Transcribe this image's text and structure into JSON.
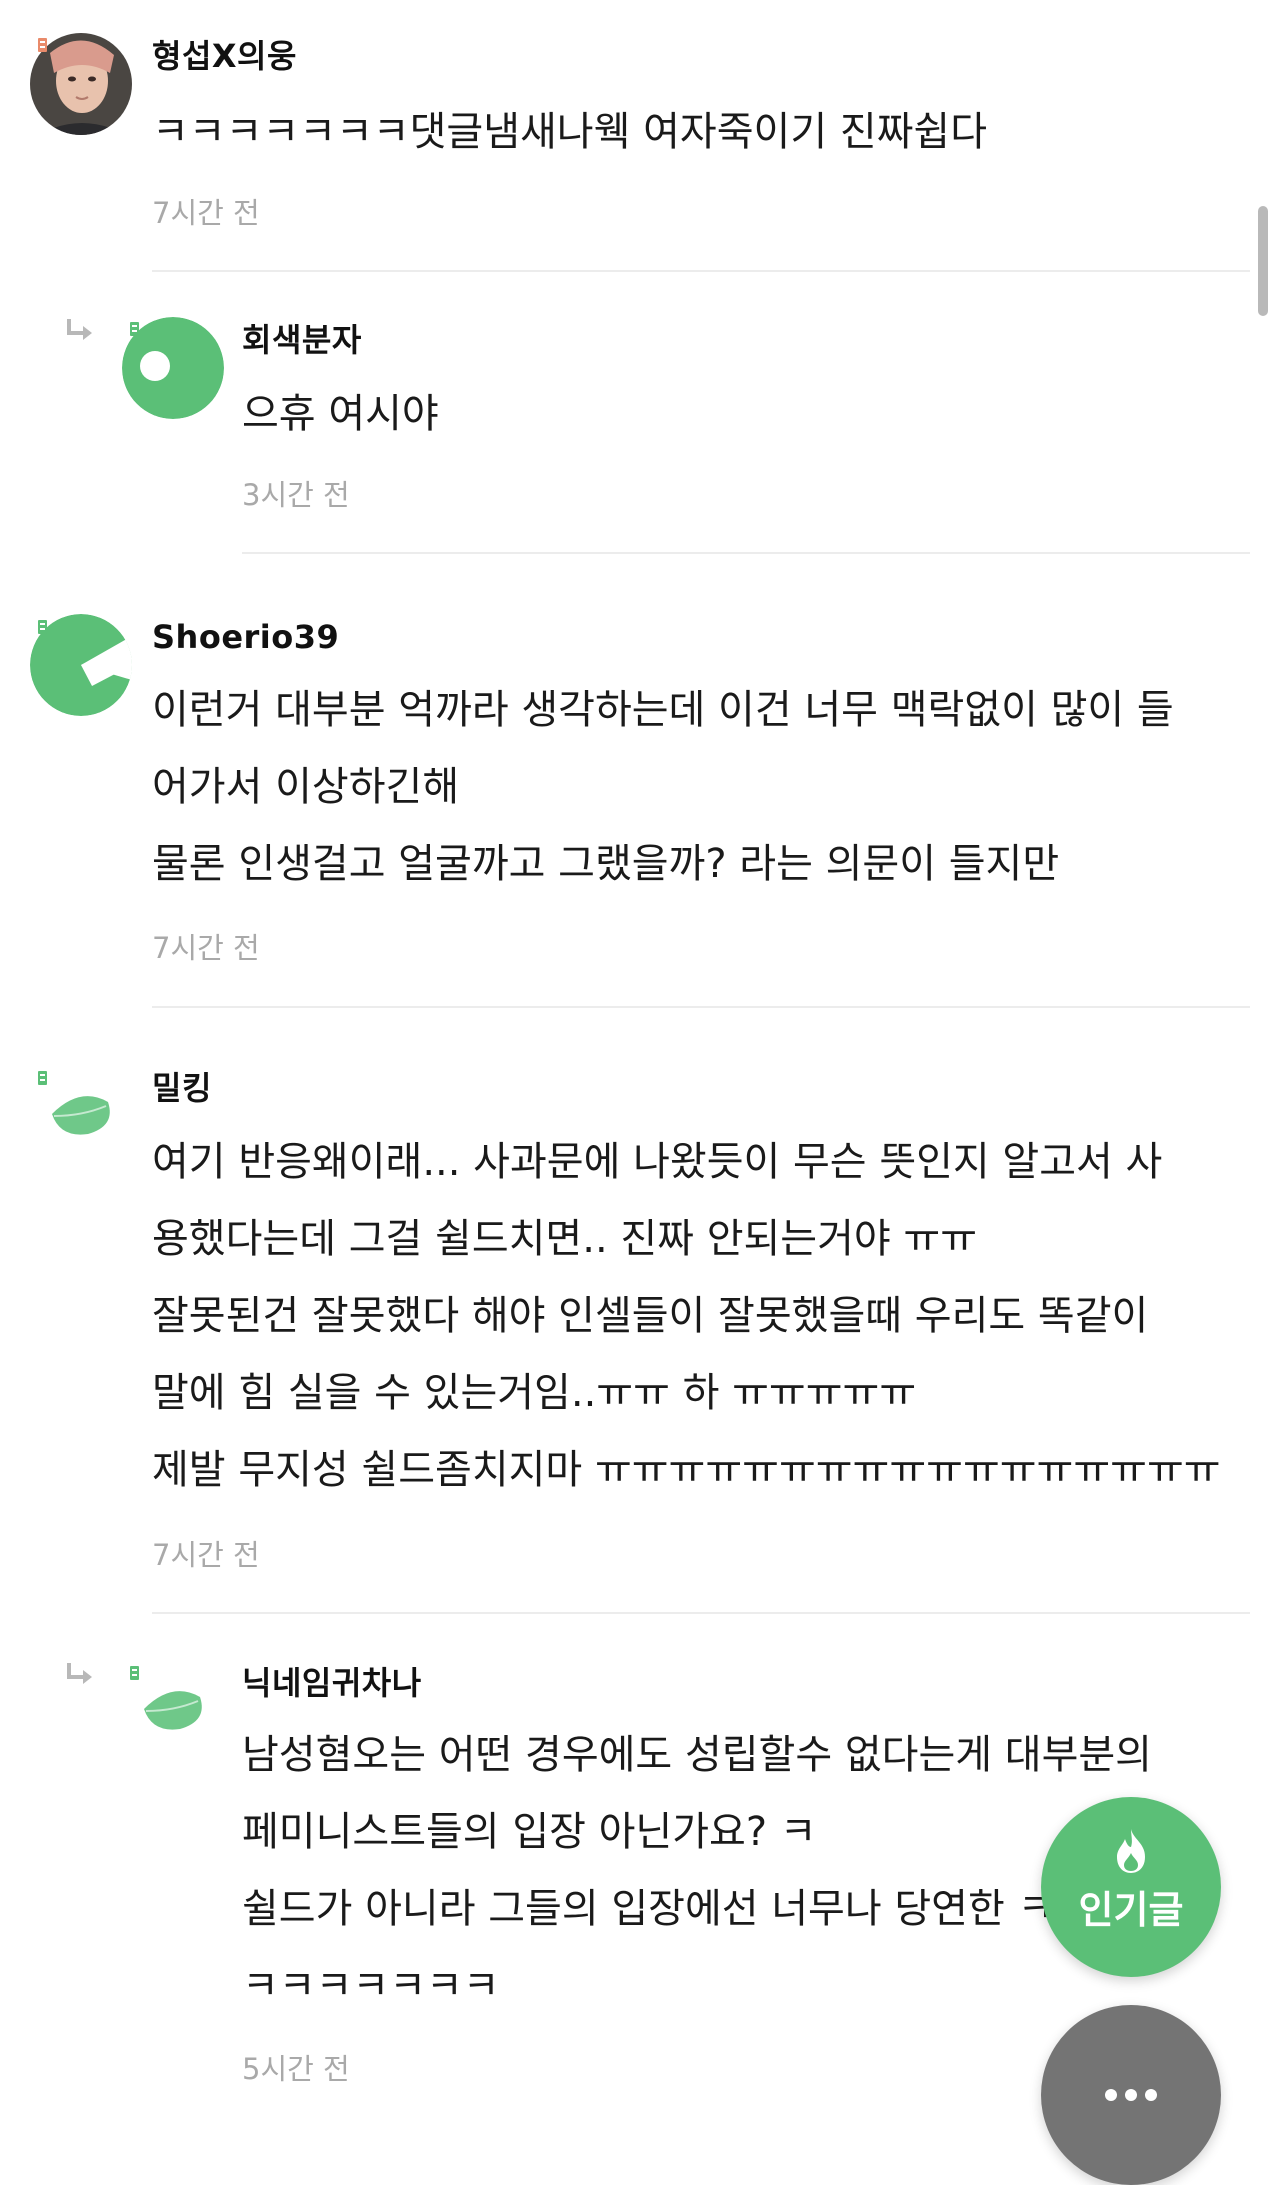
{
  "comments": [
    {
      "nickname": "형섭X의웅",
      "lines": [
        "ㅋㅋㅋㅋㅋㅋㅋ댓글냄새나웩 여자죽이기 진짜쉽다"
      ],
      "time": "7시간 전",
      "avatar": "photo-avatar",
      "is_reply": false
    },
    {
      "nickname": "회색분자",
      "lines": [
        "으휴 여시야"
      ],
      "time": "3시간 전",
      "avatar": "green-circle-avatar",
      "is_reply": true
    },
    {
      "nickname": "Shoerio39",
      "lines": [
        "이런거 대부분 억까라 생각하는데 이건 너무 맥락없이 많이 들",
        "어가서 이상하긴해",
        "물론 인생걸고 얼굴까고 그랬을까? 라는 의문이 들지만"
      ],
      "time": "7시간 전",
      "avatar": "green-pacman-avatar",
      "is_reply": false
    },
    {
      "nickname": "밀킹",
      "lines": [
        "여기 반응왜이래... 사과문에 나왔듯이 무슨 뜻인지 알고서 사",
        "용했다는데 그걸 쉴드치면.. 진짜 안되는거야 ㅠㅠ",
        "잘못된건 잘못했다 해야 인셀들이 잘못했을때 우리도 똑같이",
        "말에 힘 실을 수 있는거임..ㅠㅠ 하 ㅠㅠㅠㅠㅠ",
        "제발 무지성 쉴드좀치지마 ㅠㅠㅠㅠㅠㅠㅠㅠㅠㅠㅠㅠㅠㅠㅠㅠㅠ"
      ],
      "time": "7시간 전",
      "avatar": "leaf-avatar",
      "is_reply": false
    },
    {
      "nickname": "닉네임귀차나",
      "lines": [
        "남성혐오는 어떤 경우에도 성립할수 없다는게 대부분의",
        "페미니스트들의 입장 아닌가요? ㅋ",
        "쉴드가 아니라 그들의 입장에선 너무나 당연한 ㅋ",
        "ㅋㅋㅋㅋㅋㅋㅋ"
      ],
      "time": "5시간 전",
      "avatar": "leaf-avatar",
      "is_reply": true
    }
  ],
  "fab": {
    "popular_label": "인기글",
    "popular_icon": "fire-icon",
    "more_icon": "more-dots-icon"
  },
  "colors": {
    "accent_green": "#5bbf77",
    "timestamp_gray": "#a9a9a9",
    "fab_gray": "#747474"
  }
}
